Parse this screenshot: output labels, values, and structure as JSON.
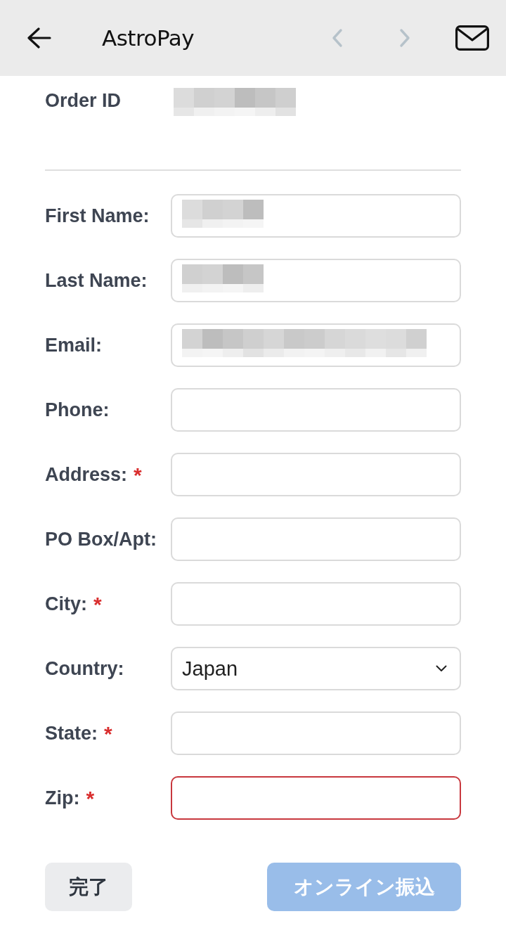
{
  "header": {
    "title": "AstroPay",
    "nav": [
      {
        "kind": "prev",
        "disabled": true
      },
      {
        "kind": "next",
        "disabled": true
      }
    ]
  },
  "order": {
    "label": "Order ID",
    "masked": true
  },
  "fields": [
    {
      "label": "First Name:",
      "kind": "text",
      "masked": true,
      "invalid": false
    },
    {
      "label": "Last Name:",
      "kind": "text",
      "masked": true,
      "invalid": false
    },
    {
      "label": "Email:",
      "kind": "email",
      "masked": true,
      "invalid": false
    },
    {
      "label": "Phone:",
      "kind": "text",
      "masked": false,
      "invalid": false
    },
    {
      "label": "Address:",
      "required_mark": "*",
      "kind": "text",
      "masked": false,
      "invalid": false
    },
    {
      "label": "PO Box/Apt:",
      "kind": "text",
      "masked": false,
      "invalid": false
    },
    {
      "label": "City:",
      "required_mark": "*",
      "kind": "text",
      "masked": false,
      "invalid": false
    },
    {
      "label": "Country:",
      "kind": "select",
      "value": "Japan",
      "invalid": false
    },
    {
      "label": "State:",
      "required_mark": "*",
      "kind": "text",
      "masked": false,
      "invalid": false
    },
    {
      "label": "Zip:",
      "required_mark": "*",
      "kind": "text",
      "masked": false,
      "invalid": true
    }
  ],
  "buttons": [
    {
      "label": "完了",
      "kind": "secondary",
      "disabled": false
    },
    {
      "label": "オンライン振込",
      "kind": "primary",
      "disabled": true
    }
  ]
}
